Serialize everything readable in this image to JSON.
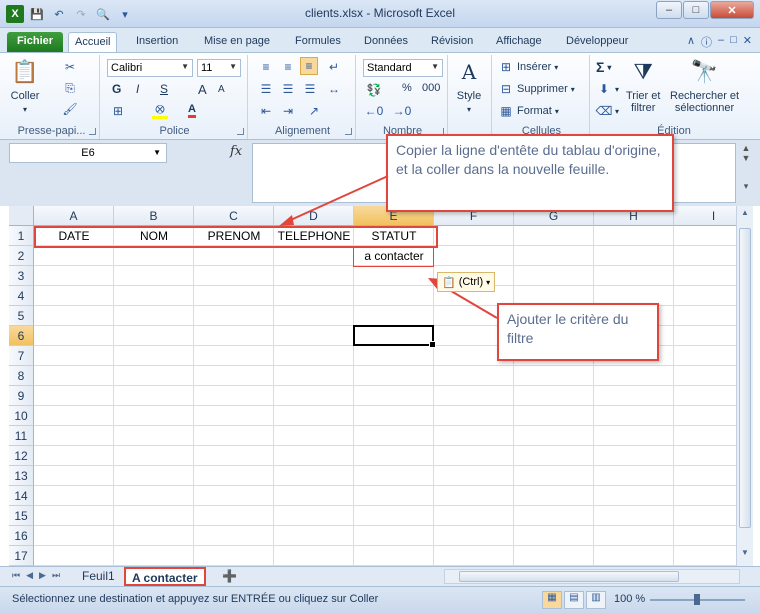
{
  "window": {
    "title": "clients.xlsx  -  Microsoft Excel",
    "controls": [
      "minimize",
      "maximize",
      "close"
    ]
  },
  "qat": {
    "icons": [
      "excel-icon",
      "save-icon",
      "undo-icon",
      "redo-icon",
      "print-preview-icon",
      "customize-icon"
    ]
  },
  "ribbon_tabs": [
    "Fichier",
    "Accueil",
    "Insertion",
    "Mise en page",
    "Formules",
    "Données",
    "Révision",
    "Affichage",
    "Développeur"
  ],
  "active_tab": "Accueil",
  "ribbon": {
    "clipboard": {
      "paste_label": "Coller",
      "group_label": "Presse-papi..."
    },
    "font": {
      "font_name": "Calibri",
      "font_size": "11",
      "bold": "G",
      "italic": "I",
      "underline": "S",
      "group_label": "Police",
      "grow": "A",
      "shrink": "A",
      "font_color": "A"
    },
    "alignment": {
      "group_label": "Alignement"
    },
    "number": {
      "format": "Standard",
      "percent": "%",
      "thousands": "000",
      "group_label": "Nombre"
    },
    "styles": {
      "label": "Style"
    },
    "cells": {
      "insert": "Insérer",
      "delete": "Supprimer",
      "format": "Format",
      "group_label": "Cellules"
    },
    "editing": {
      "sum": "Σ",
      "sort_filter": "Trier et\nfiltrer",
      "find_select": "Rechercher et\nsélectionner",
      "group_label": "Édition"
    },
    "accent": "#1f7a1f"
  },
  "formula_bar": {
    "name_box": "E6",
    "fx": "fx",
    "value": ""
  },
  "grid": {
    "columns": [
      "A",
      "B",
      "C",
      "D",
      "E",
      "F",
      "G",
      "H",
      "I"
    ],
    "rows": [
      "1",
      "2",
      "3",
      "4",
      "5",
      "6",
      "7",
      "8",
      "9",
      "10",
      "11",
      "12",
      "13",
      "14",
      "15",
      "16",
      "17"
    ],
    "selected_column": "E",
    "selected_row": "6",
    "cells": {
      "A1": "DATE",
      "B1": "NOM",
      "C1": "PRENOM",
      "D1": "TELEPHONE",
      "E1": "STATUT",
      "E2": "a contacter"
    }
  },
  "paste_options": {
    "label": "(Ctrl)"
  },
  "callouts": {
    "copy_header": "Copier la ligne d'entête du tablau d'origine, et la coller dans la nouvelle feuille.",
    "filter_criteria": "Ajouter le critère du filtre"
  },
  "sheets": [
    {
      "name": "Feuil1",
      "active": false
    },
    {
      "name": "A contacter",
      "active": true
    }
  ],
  "status": {
    "message": "Sélectionnez une destination et appuyez sur ENTRÉE ou cliquez sur Coller",
    "zoom": "100 %"
  },
  "highlight_color": "#e0463c"
}
